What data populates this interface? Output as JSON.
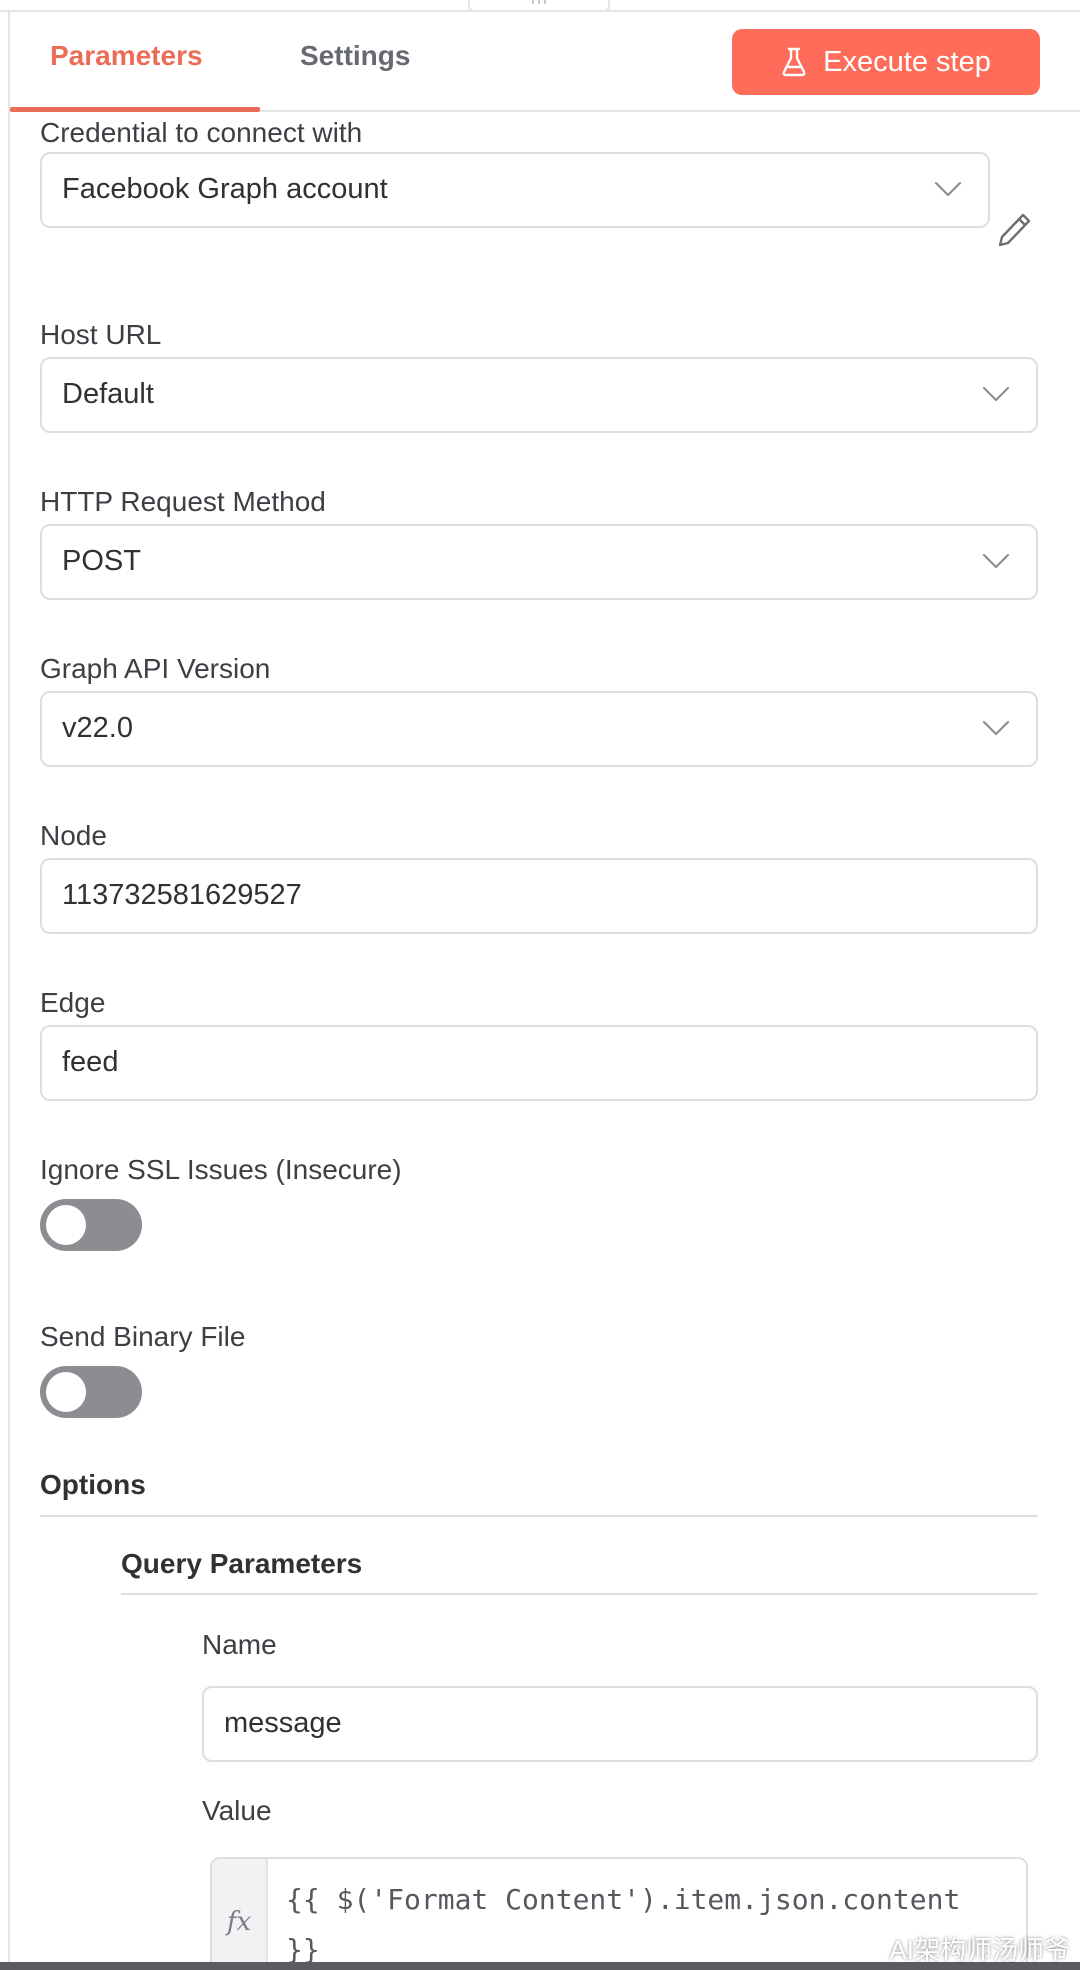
{
  "tabs": {
    "parameters": "Parameters",
    "settings": "Settings",
    "active": "parameters"
  },
  "toolbar": {
    "execute_label": "Execute step",
    "execute_icon": "flask-icon",
    "accent": "#ff6d5a"
  },
  "form": {
    "credential": {
      "label": "Credential to connect with",
      "value": "Facebook Graph account",
      "edit_icon": "pencil-icon"
    },
    "host_url": {
      "label": "Host URL",
      "value": "Default"
    },
    "http_method": {
      "label": "HTTP Request Method",
      "value": "POST"
    },
    "graph_version": {
      "label": "Graph API Version",
      "value": "v22.0"
    },
    "node": {
      "label": "Node",
      "value": "113732581629527"
    },
    "edge": {
      "label": "Edge",
      "value": "feed"
    },
    "ignore_ssl": {
      "label": "Ignore SSL Issues (Insecure)",
      "on": false
    },
    "send_binary": {
      "label": "Send Binary File",
      "on": false
    }
  },
  "options": {
    "title": "Options",
    "query_parameters": {
      "title": "Query Parameters",
      "name": {
        "label": "Name",
        "value": "message"
      },
      "value": {
        "label": "Value",
        "fx": "fx",
        "expression": "{{ $('Format Content').item.json.content }}"
      }
    }
  },
  "watermark": "AI架构师汤师爷"
}
